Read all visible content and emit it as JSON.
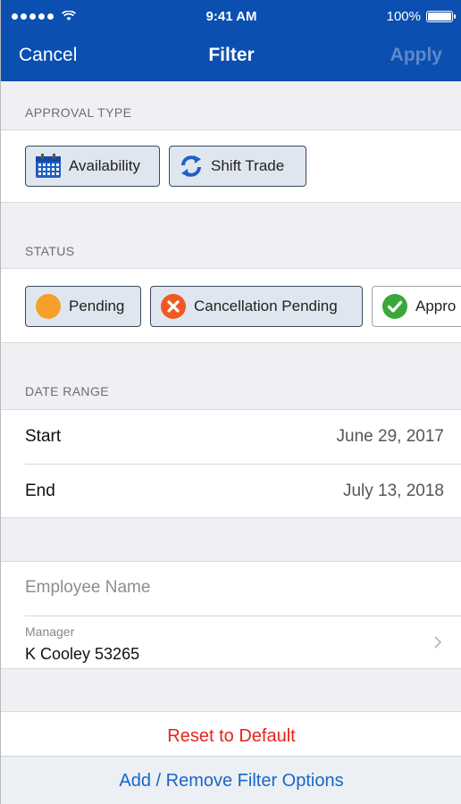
{
  "status_bar": {
    "time": "9:41 AM",
    "battery": "100%"
  },
  "nav": {
    "cancel_label": "Cancel",
    "title": "Filter",
    "apply_label": "Apply"
  },
  "approval_type": {
    "header": "APPROVAL TYPE",
    "chips": [
      {
        "label": "Availability",
        "icon": "calendar-icon"
      },
      {
        "label": "Shift Trade",
        "icon": "swap-arrows-icon"
      }
    ]
  },
  "status": {
    "header": "STATUS",
    "chips": [
      {
        "label": "Pending",
        "icon": "orange-circle-icon"
      },
      {
        "label": "Cancellation Pending",
        "icon": "x-circle-icon"
      },
      {
        "label": "Appro",
        "icon": "check-circle-icon"
      }
    ]
  },
  "date_range": {
    "header": "DATE RANGE",
    "start_label": "Start",
    "start_value": "June 29, 2017",
    "end_label": "End",
    "end_value": "July 13, 2018"
  },
  "people": {
    "employee_placeholder": "Employee Name",
    "manager_label": "Manager",
    "manager_value": "K Cooley 53265"
  },
  "actions": {
    "reset_label": "Reset to Default",
    "add_remove_label": "Add / Remove Filter Options"
  },
  "colors": {
    "brand_blue": "#0b4fb0",
    "reset_red": "#e8231d",
    "link_blue": "#1866c9",
    "pending_orange": "#f5a02a",
    "cancel_orange": "#f05a22",
    "approved_green": "#3aa73a"
  }
}
